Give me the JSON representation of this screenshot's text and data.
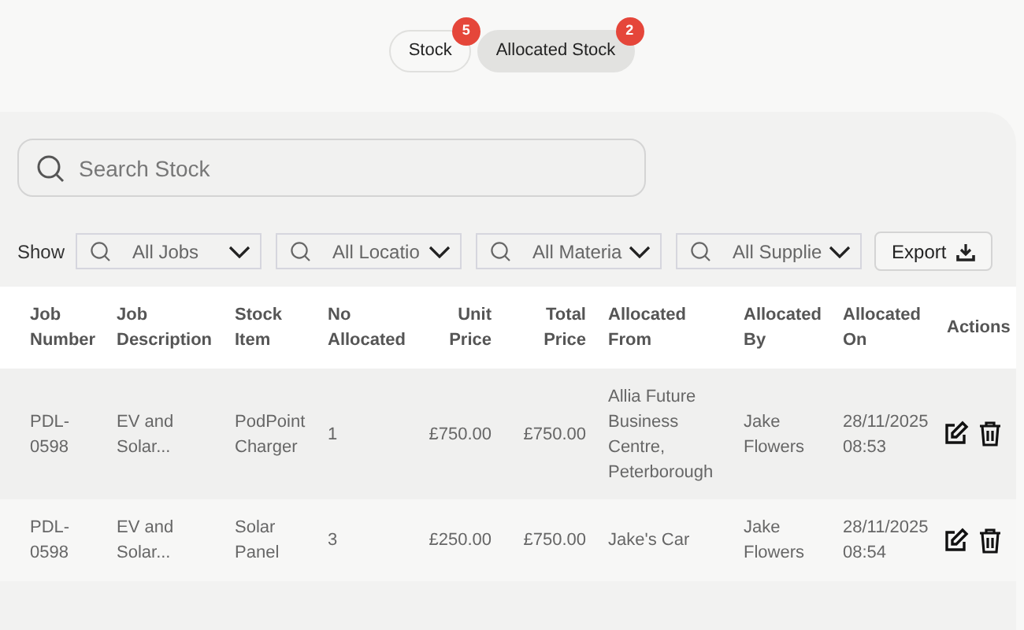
{
  "tabs": [
    {
      "label": "Stock",
      "badge": "5",
      "selected": false
    },
    {
      "label": "Allocated Stock",
      "badge": "2",
      "selected": true
    }
  ],
  "search": {
    "placeholder": "Search Stock"
  },
  "filters": {
    "label": "Show",
    "dropdowns": [
      "All Jobs",
      "All Locatio",
      "All Materia",
      "All Supplie"
    ],
    "export_button": "Export"
  },
  "table": {
    "columns": [
      "Job Number",
      "Job Description",
      "Stock Item",
      "No Allocated",
      "Unit Price",
      "Total Price",
      "Allocated From",
      "Allocated By",
      "Allocated On",
      "Actions"
    ],
    "rows": [
      {
        "cells": [
          "PDL-0598",
          "EV and Solar...",
          "PodPoint Charger",
          "1",
          "£750.00",
          "£750.00",
          "Allia Future Business Centre, Peterborough",
          "Jake Flowers",
          "28/11/2025 08:53"
        ]
      },
      {
        "cells": [
          "PDL-0598",
          "EV and Solar...",
          "Solar Panel",
          "3",
          "£250.00",
          "£750.00",
          "Jake's Car",
          "Jake Flowers",
          "28/11/2025 08:54"
        ]
      }
    ]
  }
}
